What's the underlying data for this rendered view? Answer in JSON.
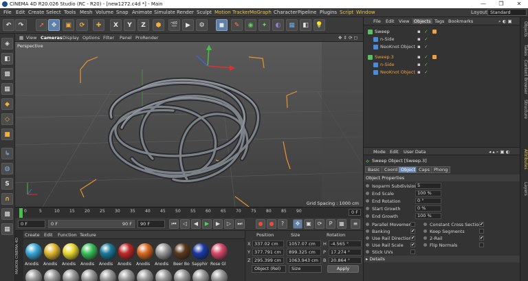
{
  "window": {
    "title": "CINEMA 4D R20.026 Studio (RC - R20) - [new1272.c4d *] - Main",
    "minimize": "—",
    "maximize": "❐",
    "close": "✕"
  },
  "menubar": {
    "items": [
      "File",
      "Edit",
      "Create",
      "Select",
      "Tools",
      "Mesh",
      "Volume",
      "Snap",
      "Animate",
      "Simulate",
      "Render",
      "Sculpt",
      "Motion Tracker",
      "MoGraph",
      "Character",
      "Pipeline",
      "Plugins",
      "Script",
      "Window"
    ],
    "highlighted": [
      "Motion Tracker",
      "MoGraph",
      "Script"
    ],
    "layout_label": "Layout:",
    "layout_value": "Standard"
  },
  "toolbar": {
    "icons": [
      "undo-icon",
      "redo-icon",
      "select-icon",
      "move-icon",
      "scale-icon",
      "rotate-icon",
      "snap-icon",
      "x-axis-icon",
      "y-axis-icon",
      "z-axis-icon",
      "world-coords-icon",
      "render-region-icon",
      "render-view-icon",
      "render-settings-icon",
      "cube-icon",
      "pen-icon",
      "subdivision-icon",
      "array-icon",
      "deformer-icon",
      "scene-icon",
      "camera-icon",
      "light-icon"
    ],
    "axis_labels": {
      "x": "X",
      "y": "Y",
      "z": "Z"
    }
  },
  "viewport": {
    "menu": [
      "View",
      "Cameras",
      "Display",
      "Options",
      "Filter",
      "Panel",
      "ProRender"
    ],
    "label": "Perspective",
    "grid_spacing": "Grid Spacing : 1000 cm"
  },
  "timeline": {
    "ticks": [
      "0",
      "5",
      "10",
      "15",
      "20",
      "25",
      "30",
      "35",
      "40",
      "45",
      "50",
      "55",
      "60",
      "65",
      "70",
      "75",
      "80",
      "85",
      "90"
    ],
    "frame_badge": "0 F"
  },
  "transport": {
    "start_frame": "0 F",
    "current_frame": "0 F",
    "range_end": "90 F",
    "end_frame": "90 F"
  },
  "materials": {
    "menu": [
      "Create",
      "Edit",
      "Function",
      "Texture"
    ],
    "items": [
      {
        "label": "Anodis",
        "color": "#3aa8d8"
      },
      {
        "label": "Anodis",
        "color": "#e0b830"
      },
      {
        "label": "Anodis",
        "color": "#e8d830"
      },
      {
        "label": "Anodis",
        "color": "#38c058"
      },
      {
        "label": "Anodis",
        "color": "#1a7a9a"
      },
      {
        "label": "Anodis",
        "color": "#c02828"
      },
      {
        "label": "Anodis",
        "color": "#d86a20"
      },
      {
        "label": "Anodis",
        "color": "#9a9a9a"
      },
      {
        "label": "Beer Bo",
        "color": "#5a3a1c"
      },
      {
        "label": "Sapphir",
        "color": "#1a3aa8"
      },
      {
        "label": "Rose Gl",
        "color": "#d84a6a"
      }
    ]
  },
  "coords": {
    "headers": {
      "position": "Position",
      "size": "Size",
      "rotation": "Rotation"
    },
    "rows": [
      {
        "axis": "X",
        "pos": "337.02 cm",
        "size": "1057.07 cm",
        "rot_axis": "H",
        "rot": "-4.565 °"
      },
      {
        "axis": "Y",
        "pos": "377.791 cm",
        "size": "899.325 cm",
        "rot_axis": "P",
        "rot": "17.274 °"
      },
      {
        "axis": "Z",
        "pos": "295.399 cm",
        "size": "1063.943 cm",
        "rot_axis": "B",
        "rot": "20.864 °"
      }
    ],
    "mode": "Object (Rel)",
    "size_mode": "Size",
    "apply": "Apply"
  },
  "objects": {
    "menu": [
      "File",
      "Edit",
      "View",
      "Objects",
      "Tags",
      "Bookmarks"
    ],
    "active_tab": "Objects",
    "rows": [
      {
        "name": "Sweep",
        "indent": 0,
        "color": "#e0e0e0",
        "icon": "#58c060"
      },
      {
        "name": "n-Side",
        "indent": 1,
        "color": "#cfcfcf",
        "icon": "#4a8ad8"
      },
      {
        "name": "NeoKnot Object",
        "indent": 1,
        "color": "#cfcfcf",
        "icon": "#4a8ad8"
      },
      {
        "name": "Sweep.3",
        "indent": 0,
        "color": "#f0a040",
        "icon": "#58c060"
      },
      {
        "name": "n-Side",
        "indent": 1,
        "color": "#f0a040",
        "icon": "#4a8ad8"
      },
      {
        "name": "NeoKnot Object",
        "indent": 1,
        "color": "#f0a040",
        "icon": "#4a8ad8"
      }
    ]
  },
  "attributes": {
    "menu": [
      "Mode",
      "Edit",
      "User Data"
    ],
    "title": "Sweep Object [Sweep.3]",
    "tabs": [
      "Basic",
      "Coord.",
      "Object",
      "Caps",
      "Phong"
    ],
    "active_tab": "Object",
    "section": "Object Properties",
    "props": [
      {
        "label": "Isoparm Subdivision",
        "value": "5"
      },
      {
        "label": "End Scale",
        "value": "100 %"
      },
      {
        "label": "End Rotation",
        "value": "0 °"
      },
      {
        "label": "Start Growth",
        "value": "0 %"
      },
      {
        "label": "End Growth",
        "value": "100 %"
      }
    ],
    "checks_left": [
      {
        "label": "Parallel Movement",
        "checked": ""
      },
      {
        "label": "Banking",
        "checked": "✔"
      },
      {
        "label": "Use Rail Direction",
        "checked": "✔"
      },
      {
        "label": "Use Rail Scale",
        "checked": "✔"
      },
      {
        "label": "Stick UVs",
        "checked": ""
      }
    ],
    "checks_right": [
      {
        "label": "Constant Cross Section",
        "checked": "✔"
      },
      {
        "label": "Keep Segments",
        "checked": ""
      },
      {
        "label": "2-Rail",
        "checked": "✔"
      },
      {
        "label": "Flip Normals",
        "checked": ""
      }
    ],
    "details": "Details"
  },
  "side_tabs": [
    "Objects",
    "Takes",
    "Content Browser",
    "Structure",
    "Attributes",
    "Layers"
  ],
  "active_side_tab": "Attributes"
}
